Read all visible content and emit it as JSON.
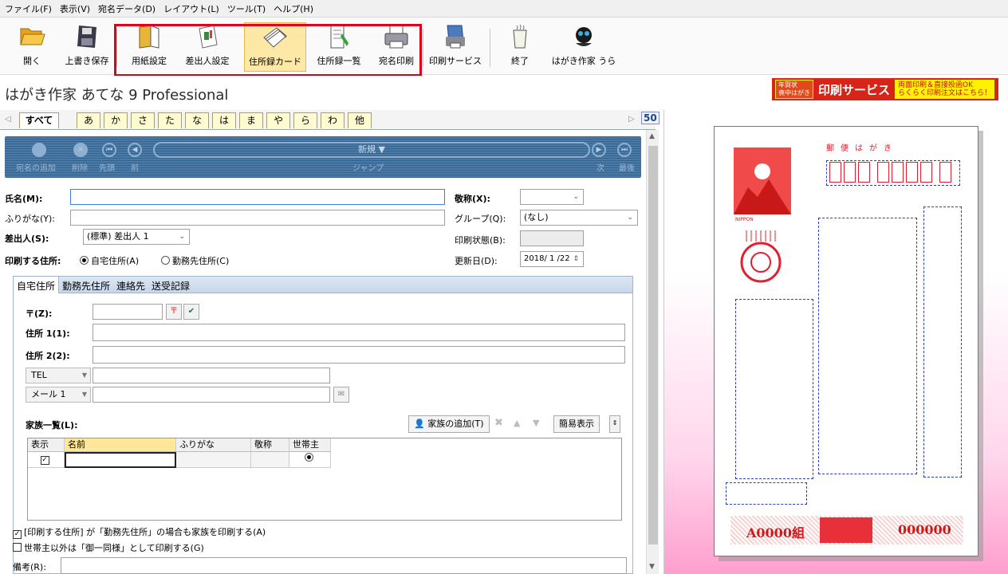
{
  "menu": [
    "ファイル(F)",
    "表示(V)",
    "宛名データ(D)",
    "レイアウト(L)",
    "ツール(T)",
    "ヘルプ(H)"
  ],
  "toolbar": {
    "open": "開く",
    "overwrite_save": "上書き保存",
    "paper_settings": "用紙設定",
    "sender_settings": "差出人設定",
    "address_card": "住所録カード",
    "address_list": "住所録一覧",
    "print_address": "宛名印刷",
    "print_service": "印刷サービス",
    "exit": "終了",
    "hagaki_sakka_ura": "はがき作家 うら"
  },
  "app_title": "はがき作家 あてな 9 Professional",
  "promo": {
    "line1": "年賀状",
    "line2": "喪中はがき",
    "brand": "はがき作家",
    "service": "印刷サービス",
    "offer1": "両面印刷＆直接投函OK",
    "offer2": "らくらく印刷注文はこちら！"
  },
  "kana_tabs": [
    "すべて",
    "あ",
    "か",
    "さ",
    "た",
    "な",
    "は",
    "ま",
    "や",
    "ら",
    "わ",
    "他"
  ],
  "fifty_label": "50",
  "nav": {
    "new_label": "新規 ▼",
    "jump_label": "ジャンプ",
    "add_label": "宛名の追加",
    "delete_label": "削除",
    "first_label": "先頭",
    "prev_label": "前",
    "next_label": "次",
    "last_label": "最後"
  },
  "form": {
    "name_label": "氏名(M):",
    "furigana_label": "ふりがな(Y):",
    "sender_label": "差出人(S):",
    "sender_value": "(標準) 差出人 1",
    "print_addr_label": "印刷する住所:",
    "home_addr": "自宅住所(A)",
    "work_addr": "勤務先住所(C)",
    "honorific_label": "敬称(X):",
    "group_label": "グループ(Q):",
    "group_value": "(なし)",
    "print_status_label": "印刷状態(B):",
    "updated_label": "更新日(D):",
    "updated_value": "2018/ 1 /22"
  },
  "subtabs": [
    "自宅住所",
    "勤務先住所",
    "連絡先",
    "送受記録"
  ],
  "addr": {
    "zip_label": "〒(Z):",
    "addr1_label": "住所 1(1):",
    "addr2_label": "住所 2(2):",
    "tel_label": "TEL",
    "mail_label": "メール 1"
  },
  "family": {
    "title": "家族一覧(L):",
    "add_button": "家族の追加(T)",
    "simple_view": "簡易表示",
    "columns": [
      "表示",
      "名前",
      "ふりがな",
      "敬称",
      "世帯主"
    ]
  },
  "checks": {
    "c1": "[印刷する住所] が「勤務先住所」の場合も家族を印刷する(A)",
    "c2": "世帯主以外は「御一同様」として印刷する(G)"
  },
  "memo_label": "備考(R):",
  "card": {
    "yubin": "郵便はがき",
    "kumi": "A0000組",
    "number": "000000"
  },
  "colors": {
    "accent_red": "#e00018",
    "nav_blue": "#3f6e9c"
  }
}
